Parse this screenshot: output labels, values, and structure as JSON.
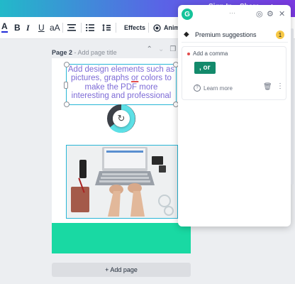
{
  "topbar": {
    "sign_in": "Sign In",
    "share": "Share"
  },
  "toolbar": {
    "font_color_label": "A",
    "bold_label": "B",
    "italic_label": "I",
    "underline_label": "U",
    "case_label": "aA",
    "effects_label": "Effects",
    "animate_label": "Anim"
  },
  "page": {
    "title": "Page 2",
    "title_placeholder": "- Add page title",
    "text_content_before": "Add design elements such as pictures, graphs ",
    "text_error_word": "or",
    "text_content_after": " colors to make the PDF more interesting and professional",
    "add_page_label": "+ Add page"
  },
  "grammarly": {
    "logo_letter": "G",
    "premium_label": "Premium suggestions",
    "premium_count": "1",
    "card_title": "Add a comma",
    "suggestion_text": ", or",
    "learn_more": "Learn more"
  },
  "colors": {
    "accent": "#29b6d6",
    "text_color": "#7d6bd6",
    "grammarly_green": "#15c39a",
    "suggestion_green": "#138a6b",
    "teal_block": "#19d9a3",
    "error_red": "#e24c4c"
  }
}
